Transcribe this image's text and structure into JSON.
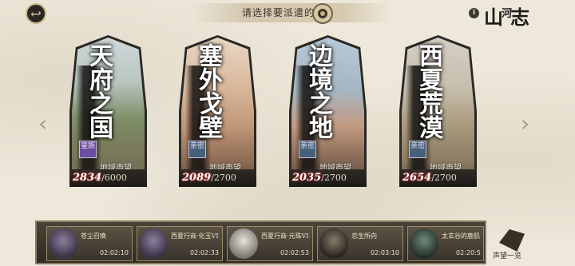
{
  "header": {
    "back_icon": "back-arrow-icon",
    "prompt": "请选择要派遣的",
    "emblem_icon": "compass-emblem-icon",
    "info_icon": "info-icon",
    "info_symbol": "i",
    "logo_main": "山",
    "logo_small": "河",
    "logo_end": "志"
  },
  "nav": {
    "left_arrow": "‹",
    "right_arrow": "›"
  },
  "regions": [
    {
      "title": "天府之国",
      "badge": "皇族",
      "badge_color": "#6b4fa0",
      "label": "地域声望",
      "current": "2834",
      "max": "/6000"
    },
    {
      "title": "塞外戈壁",
      "badge": "亲密",
      "badge_color": "#46607a",
      "label": "地域声望",
      "current": "2089",
      "max": "/2700"
    },
    {
      "title": "边境之地",
      "badge": "亲密",
      "badge_color": "#46607a",
      "label": "地域声望",
      "current": "2035",
      "max": "/2700"
    },
    {
      "title": "西夏荒漠",
      "badge": "亲密",
      "badge_color": "#46607a",
      "label": "地域声望",
      "current": "2654",
      "max": "/2700"
    }
  ],
  "dispatch": [
    {
      "name": "苍尘召唤",
      "time": "02:02:10"
    },
    {
      "name": "西夏行商·化玉VI",
      "time": "02:02:33"
    },
    {
      "name": "西夏行商·元珠VI",
      "time": "02:02:53"
    },
    {
      "name": "恋生所向",
      "time": "02:03:10"
    },
    {
      "name": "太玄谷的鹿肌",
      "time": "02:20:5"
    }
  ],
  "overview": {
    "icon": "reputation-scroll-icon",
    "label": "声望一览"
  }
}
